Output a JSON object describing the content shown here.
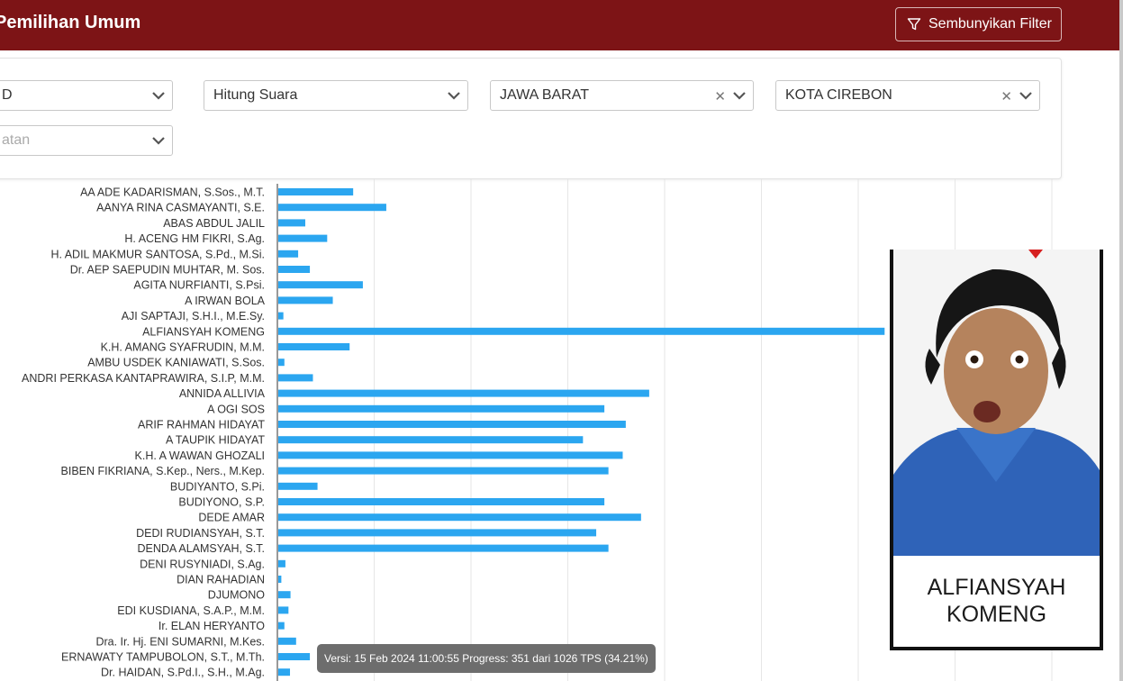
{
  "header": {
    "title": "Pemilihan Umum",
    "filter_button_label": "Sembunyikan Filter"
  },
  "filters": {
    "select_1": "D",
    "select_2": "Hitung Suara",
    "select_3": "JAWA BARAT",
    "select_4": "KOTA CIREBON",
    "select_5_placeholder": "atan"
  },
  "chart_data": {
    "type": "bar",
    "orientation": "horizontal",
    "grid": true,
    "bar_color": "#2ba6f0",
    "xlim": [
      0,
      7600
    ],
    "categories": [
      "AA ADE KADARISMAN, S.Sos., M.T.",
      "AANYA RINA CASMAYANTI, S.E.",
      "ABAS ABDUL JALIL",
      "H. ACENG HM FIKRI, S.Ag.",
      "H. ADIL MAKMUR SANTOSA, S.Pd., M.Si.",
      "Dr. AEP SAEPUDIN MUHTAR, M. Sos.",
      "AGITA NURFIANTI, S.Psi.",
      "A IRWAN BOLA",
      "AJI SAPTAJI, S.H.I., M.E.Sy.",
      "ALFIANSYAH KOMENG",
      "K.H. AMANG SYAFRUDIN, M.M.",
      "AMBU USDEK KANIAWATI, S.Sos.",
      "ANDRI PERKASA KANTAPRAWIRA, S.I.P, M.M.",
      "ANNIDA ALLIVIA",
      "A OGI SOS",
      "ARIF RAHMAN HIDAYAT",
      "A TAUPIK HIDAYAT",
      "K.H. A WAWAN GHOZALI",
      "BIBEN FIKRIANA, S.Kep., Ners., M.Kep.",
      "BUDIYANTO, S.Pi.",
      "BUDIYONO, S.P.",
      "DEDE AMAR",
      "DEDI RUDIANSYAH, S.T.",
      "DENDA ALAMSYAH, S.T.",
      "DENI RUSYNIADI, S.Ag.",
      "DIAN RAHADIAN",
      "DJUMONO",
      "EDI KUSDIANA, S.A.P., M.M.",
      "Ir. ELAN HERYANTO",
      "Dra. Ir. Hj. ENI SUMARNI, M.Kes.",
      "ERNAWATY TAMPUBOLON, S.T., M.Th.",
      "Dr. HAIDAN, S.Pd.I., S.H., M.Ag."
    ],
    "values": [
      735,
      1060,
      265,
      480,
      195,
      310,
      830,
      535,
      50,
      5950,
      700,
      60,
      340,
      3640,
      3200,
      3410,
      2990,
      3380,
      3240,
      385,
      3200,
      3560,
      3120,
      3240,
      70,
      30,
      120,
      100,
      60,
      175,
      310,
      115
    ]
  },
  "overlay": {
    "caption_line1": "ALFIANSYAH",
    "caption_line2": "KOMENG"
  },
  "tooltip": {
    "text": "Versi: 15 Feb 2024 11:00:55 Progress: 351 dari 1026 TPS (34.21%)"
  }
}
